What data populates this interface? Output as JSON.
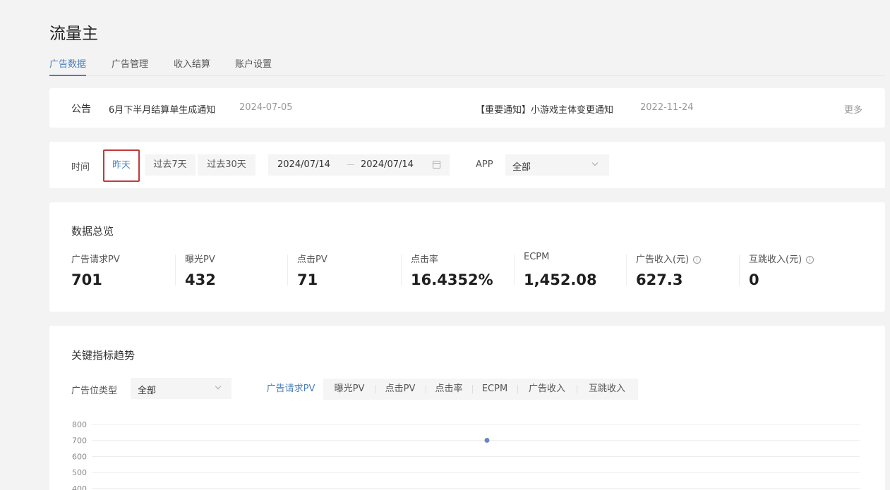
{
  "app": {
    "title": "流量主"
  },
  "tabs": [
    {
      "label": "广告数据",
      "active": true
    },
    {
      "label": "广告管理",
      "active": false
    },
    {
      "label": "收入结算",
      "active": false
    },
    {
      "label": "账户设置",
      "active": false
    }
  ],
  "notice": {
    "label": "公告",
    "items": [
      {
        "title": "6月下半月结算单生成通知",
        "date": "2024-07-05"
      },
      {
        "title": "【重要通知】小游戏主体变更通知",
        "date": "2022-11-24"
      }
    ],
    "more": "更多"
  },
  "filter": {
    "time_label": "时间",
    "ranges": [
      {
        "label": "昨天",
        "active": true
      },
      {
        "label": "过去7天",
        "active": false
      },
      {
        "label": "过去30天",
        "active": false
      }
    ],
    "start_date": "2024/07/14",
    "end_date": "2024/07/14",
    "app_label": "APP",
    "app_value": "全部"
  },
  "overview": {
    "title": "数据总览",
    "metrics": [
      {
        "label": "广告请求PV",
        "value": "701",
        "info": false
      },
      {
        "label": "曝光PV",
        "value": "432",
        "info": false
      },
      {
        "label": "点击PV",
        "value": "71",
        "info": false
      },
      {
        "label": "点击率",
        "value": "16.4352%",
        "info": false
      },
      {
        "label": "ECPM",
        "value": "1,452.08",
        "info": false
      },
      {
        "label": "广告收入(元)",
        "value": "627.3",
        "info": true
      },
      {
        "label": "互跳收入(元)",
        "value": "0",
        "info": true
      }
    ]
  },
  "trend": {
    "title": "关键指标趋势",
    "slot_type_label": "广告位类型",
    "slot_type_value": "全部",
    "metric_tabs": [
      {
        "label": "广告请求PV",
        "active": true
      },
      {
        "label": "曝光PV",
        "active": false
      },
      {
        "label": "点击PV",
        "active": false
      },
      {
        "label": "点击率",
        "active": false
      },
      {
        "label": "ECPM",
        "active": false
      },
      {
        "label": "广告收入",
        "active": false
      },
      {
        "label": "互跳收入",
        "active": false
      }
    ]
  },
  "chart_data": {
    "type": "line",
    "title": "",
    "xlabel": "",
    "ylabel": "",
    "y_ticks": [
      400,
      500,
      600,
      700,
      800
    ],
    "ylim": [
      400,
      800
    ],
    "grid": true,
    "series": [
      {
        "values": [
          701
        ]
      }
    ],
    "colors": {
      "point": "#6b86c5",
      "grid": "#ececec"
    }
  }
}
